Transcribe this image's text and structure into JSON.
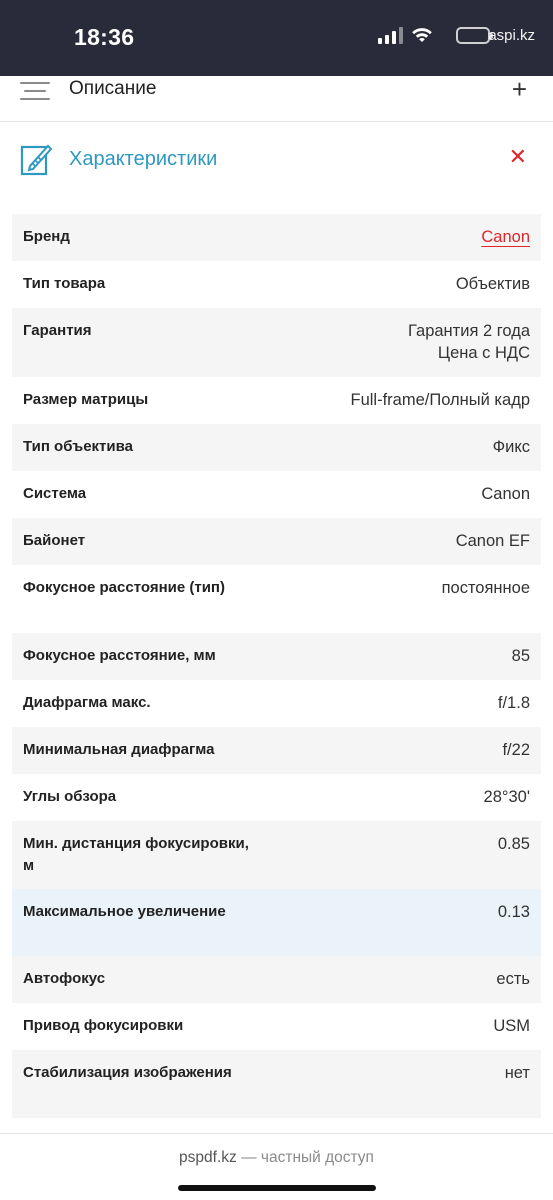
{
  "status_bar": {
    "time": "18:36",
    "site_badge": "aspi.kz"
  },
  "description": {
    "title": "Описание",
    "expand_symbol": "+"
  },
  "characteristics": {
    "title": "Характеристики",
    "close_symbol": "✕"
  },
  "specs": [
    {
      "name": "Бренд",
      "value": "Canon",
      "link": true
    },
    {
      "name": "Тип товара",
      "value": "Объектив"
    },
    {
      "name": "Гарантия",
      "value": "Гарантия 2 года\nЦена с НДС"
    },
    {
      "name": "Размер матрицы",
      "value": "Full-frame/Полный кадр"
    },
    {
      "name": "Тип объектива",
      "value": "Фикс"
    },
    {
      "name": "Система",
      "value": "Canon"
    },
    {
      "name": "Байонет",
      "value": "Canon EF"
    },
    {
      "name": "Фокусное расстояние (тип)",
      "value": "постоянное"
    },
    {
      "name": "Фокусное расстояние, мм",
      "value": "85"
    },
    {
      "name": "Диафрагма макс.",
      "value": "f/1.8"
    },
    {
      "name": "Минимальная диафрагма",
      "value": "f/22"
    },
    {
      "name": "Углы обзора",
      "value": "28°30'"
    },
    {
      "name": "Мин. дистанция фокусировки, м",
      "value": "0.85"
    },
    {
      "name": "Максимальное увеличение",
      "value": "0.13",
      "highlighted": true
    },
    {
      "name": "Автофокус",
      "value": "есть"
    },
    {
      "name": "Привод фокусировки",
      "value": "USM"
    },
    {
      "name": "Стабилизация изображения",
      "value": "нет"
    }
  ],
  "footer": {
    "domain": "pspdf.kz",
    "suffix": "— частный доступ"
  },
  "colors": {
    "accent_blue": "#2f98c0",
    "accent_red": "#e0262b",
    "status_bar_bg": "#2a2b3a"
  }
}
